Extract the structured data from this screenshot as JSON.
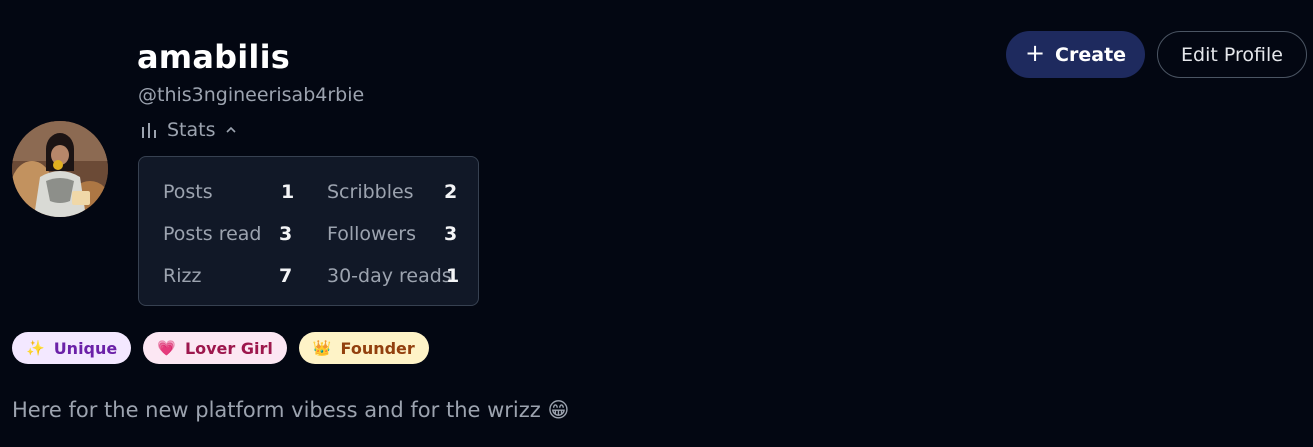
{
  "profile": {
    "username": "amabilis",
    "handle": "@this3ngineerisab4rbie",
    "bio": "Here for the new platform vibess and for the wrizz 😁"
  },
  "actions": {
    "create_label": "Create",
    "edit_label": "Edit Profile"
  },
  "stats": {
    "toggle_label": "Stats",
    "items": [
      {
        "label": "Posts",
        "value": "1"
      },
      {
        "label": "Scribbles",
        "value": "2"
      },
      {
        "label": "Posts read",
        "value": "3"
      },
      {
        "label": "Followers",
        "value": "3"
      },
      {
        "label": "Rizz",
        "value": "7"
      },
      {
        "label": "30-day reads",
        "value": "1"
      }
    ]
  },
  "badges": [
    {
      "emoji": "✨",
      "label": "Unique"
    },
    {
      "emoji": "💗",
      "label": "Lover Girl"
    },
    {
      "emoji": "👑",
      "label": "Founder"
    }
  ],
  "colors": {
    "background": "#030712",
    "create_button": "#1e2a5e",
    "card": "#111827"
  }
}
